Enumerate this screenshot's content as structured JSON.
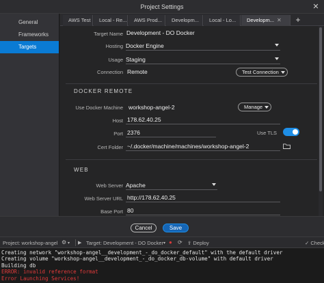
{
  "window": {
    "title": "Project Settings"
  },
  "sidebar": {
    "items": [
      {
        "label": "General",
        "active": false
      },
      {
        "label": "Frameworks",
        "active": false
      },
      {
        "label": "Targets",
        "active": true
      }
    ]
  },
  "tabs": [
    {
      "label": "AWS Test",
      "active": false
    },
    {
      "label": "Local - Re...",
      "active": false
    },
    {
      "label": "AWS Prod...",
      "active": false
    },
    {
      "label": "Developm...",
      "active": false
    },
    {
      "label": "Local - Lo...",
      "active": false
    },
    {
      "label": "Developm...",
      "active": true
    }
  ],
  "form": {
    "target_name_label": "Target Name",
    "target_name_value": "Development - DO Docker",
    "hosting_label": "Hosting",
    "hosting_value": "Docker Engine",
    "usage_label": "Usage",
    "usage_value": "Staging",
    "connection_label": "Connection",
    "connection_value": "Remote",
    "test_connection_label": "Test Connection",
    "docker_remote_heading": "DOCKER REMOTE",
    "use_docker_machine_label": "Use Docker Machine",
    "docker_machine_value": "workshop-angel-2",
    "manage_label": "Manage",
    "host_label": "Host",
    "host_value": "178.62.40.25",
    "port_label": "Port",
    "port_value": "2376",
    "use_tls_label": "Use TLS",
    "use_tls_enabled": true,
    "cert_folder_label": "Cert Folder",
    "cert_folder_value": "~/.docker/machine/machines/workshop-angel-2",
    "web_heading": "WEB",
    "web_server_label": "Web Server",
    "web_server_value": "Apache",
    "web_server_url_label": "Web Server URL",
    "web_server_url_value": "http://178.62.40.25",
    "base_port_label": "Base Port",
    "base_port_value": "80"
  },
  "footer": {
    "cancel_label": "Cancel",
    "save_label": "Save"
  },
  "statusbar": {
    "project": "Project: workshop-angel",
    "target": "Target: Development - DO Docker",
    "deploy": "Deploy",
    "check": "Check"
  },
  "console": {
    "lines": [
      {
        "text": "Creating network \"workshop-angel__development_-_do_docker_default\" with the default driver",
        "error": false
      },
      {
        "text": "Creating volume \"workshop-angel__development_-_do_docker_db-volume\" with default driver",
        "error": false
      },
      {
        "text": "Building db",
        "error": false
      },
      {
        "text": "ERROR: invalid reference format",
        "error": true
      },
      {
        "text": "Error Launching Services!",
        "error": true
      }
    ]
  },
  "colors": {
    "accent": "#0a7bd4",
    "error": "#e03a3a",
    "stop": "#d93a3a"
  }
}
